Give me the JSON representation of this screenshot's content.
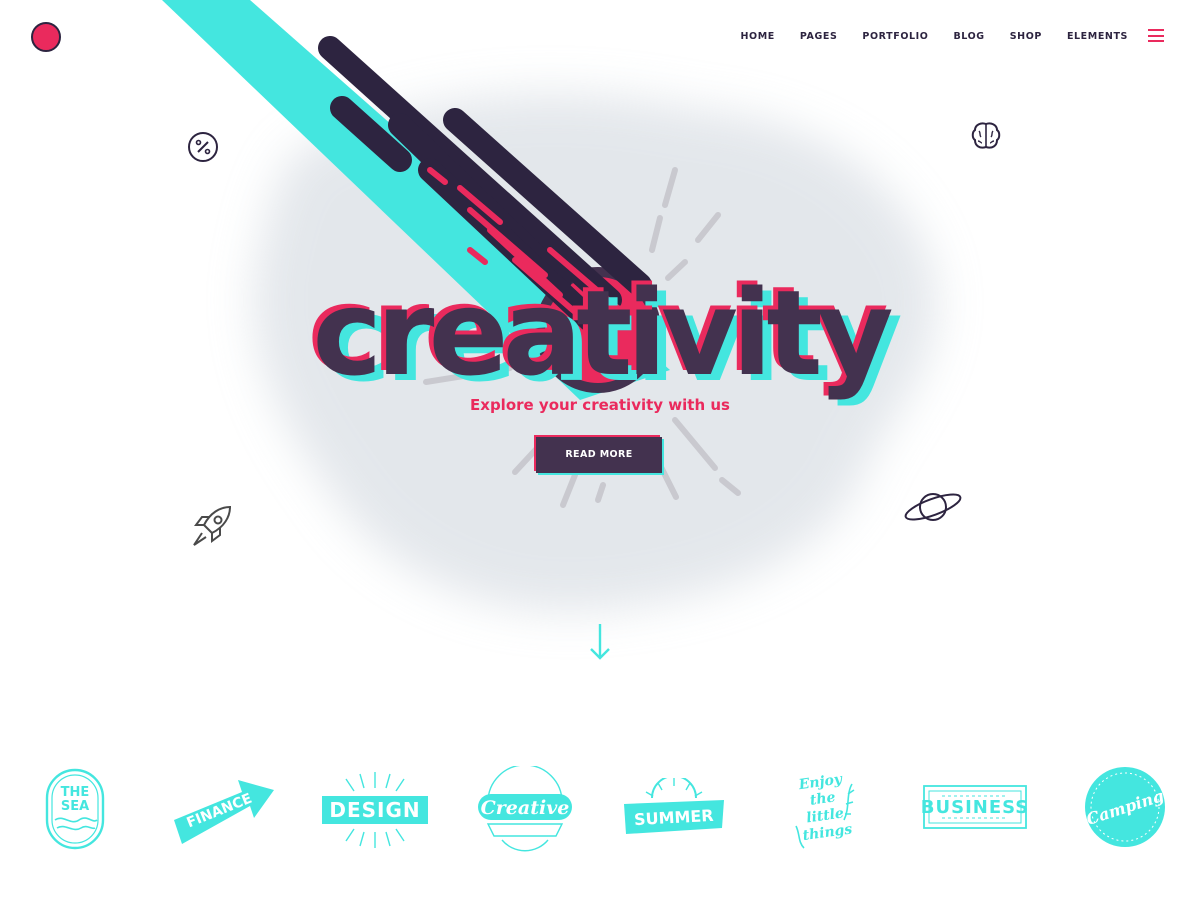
{
  "nav": {
    "items": [
      "HOME",
      "PAGES",
      "PORTFOLIO",
      "BLOG",
      "SHOP",
      "ELEMENTS"
    ],
    "active": "HOME"
  },
  "icons": {
    "logo": "logo-circle",
    "menu": "hamburger-icon",
    "left_top": "percent-icon",
    "right_top": "brain-icon",
    "left_bottom": "rocket-icon",
    "right_bottom": "planet-icon",
    "scroll": "arrow-down-icon"
  },
  "hero": {
    "headline": "creativity",
    "tagline": "Explore your creativity with us",
    "cta_label": "READ MORE"
  },
  "badges": [
    {
      "name": "the-sea",
      "label": "THE SEA"
    },
    {
      "name": "finance",
      "label": "FINANCE"
    },
    {
      "name": "design",
      "label": "DESIGN"
    },
    {
      "name": "creative",
      "label": "Creative"
    },
    {
      "name": "summer",
      "label": "SUMMER"
    },
    {
      "name": "enjoy-the-little-things",
      "label": "Enjoy the little things"
    },
    {
      "name": "business",
      "label": "BUSINESS"
    },
    {
      "name": "camping",
      "label": "Camping"
    }
  ],
  "colors": {
    "accent_pink": "#ea2a5d",
    "accent_cyan": "#44e6df",
    "dark": "#43324f"
  }
}
